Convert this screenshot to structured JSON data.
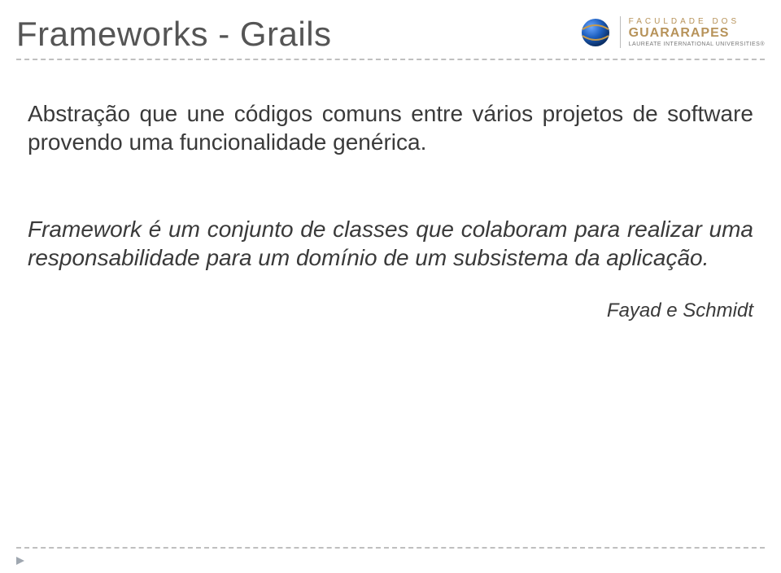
{
  "title": "Frameworks - Grails",
  "logo": {
    "line1": "FACULDADE DOS",
    "line2": "GUARARAPES",
    "line3": "LAUREATE INTERNATIONAL UNIVERSITIES®"
  },
  "body": {
    "paragraph1": "Abstração que une códigos comuns entre vários projetos de software provendo uma funcionalidade genérica.",
    "quote": "Framework é um conjunto de classes que colaboram para realizar uma responsabilidade para um domínio de um subsistema da aplicação.",
    "author": "Fayad e Schmidt"
  }
}
